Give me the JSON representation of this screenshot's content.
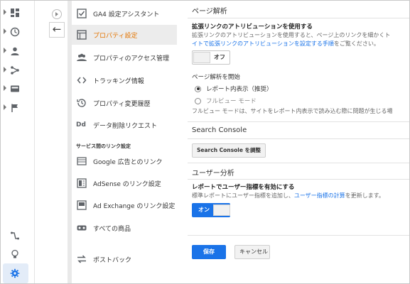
{
  "rail": {
    "icons": [
      "dashboard-icon",
      "clock-icon",
      "person-icon",
      "fork-icon",
      "display-icon",
      "flag-icon"
    ],
    "bottom_icons": [
      "link-icon",
      "lightbulb-icon",
      "gear-icon"
    ]
  },
  "nav": {
    "items": [
      {
        "label": "GA4 設定アシスタント",
        "icon": "checkbox-icon"
      },
      {
        "label": "プロパティ設定",
        "icon": "property-icon",
        "active": true
      },
      {
        "label": "プロパティのアクセス管理",
        "icon": "people-icon"
      },
      {
        "label": "トラッキング情報",
        "icon": "code-icon"
      },
      {
        "label": "プロパティ変更履歴",
        "icon": "history-icon"
      },
      {
        "label": "データ削除リクエスト",
        "icon": "dd-icon"
      }
    ],
    "section_header": "サービス間のリンク設定",
    "link_items": [
      {
        "label": "Google 広告とのリンク",
        "icon": "ads-icon"
      },
      {
        "label": "AdSense のリンク設定",
        "icon": "adsense-icon"
      },
      {
        "label": "Ad Exchange のリンク設定",
        "icon": "adexchange-icon"
      },
      {
        "label": "すべての商品",
        "icon": "products-icon"
      },
      {
        "label": "ポストバック",
        "icon": "postback-icon"
      }
    ],
    "dd_text": "Dd"
  },
  "main": {
    "page_analysis_title": "ページ解析",
    "enhanced_link_label": "拡張リンクのアトリビューションを使用する",
    "enhanced_link_desc1": "拡張リンクのアトリビューションを使用すると、ページ上のリンクを細かくト",
    "enhanced_link_desc2_link": "イトで拡張リンクのアトリビューションを設定する手順",
    "enhanced_link_desc2_tail": "をご覧ください。",
    "toggle_off": "オフ",
    "page_analysis_start_label": "ページ解析を開始",
    "radio_in_report": "レポート内表示（推奨）",
    "radio_full_view": "フルビュー モード",
    "full_view_desc": "フルビュー モードは、サイトをレポート内表示で読み込む際に問題が生じる場",
    "search_console_title": "Search Console",
    "search_console_button": "Search Console を調整",
    "user_analysis_title": "ユーザー分析",
    "user_metrics_label": "レポートでユーザー指標を有効にする",
    "user_metrics_desc_head": "標準レポートにユーザー指標を追加し、",
    "user_metrics_desc_link": "ユーザー指標の計算",
    "user_metrics_desc_tail": "を更新します。",
    "toggle_on": "オン",
    "save_button": "保存",
    "cancel_button": "キャンセル"
  },
  "colors": {
    "accent_orange": "#e37400",
    "link_blue": "#1a73e8",
    "button_blue": "#1a73e8"
  }
}
